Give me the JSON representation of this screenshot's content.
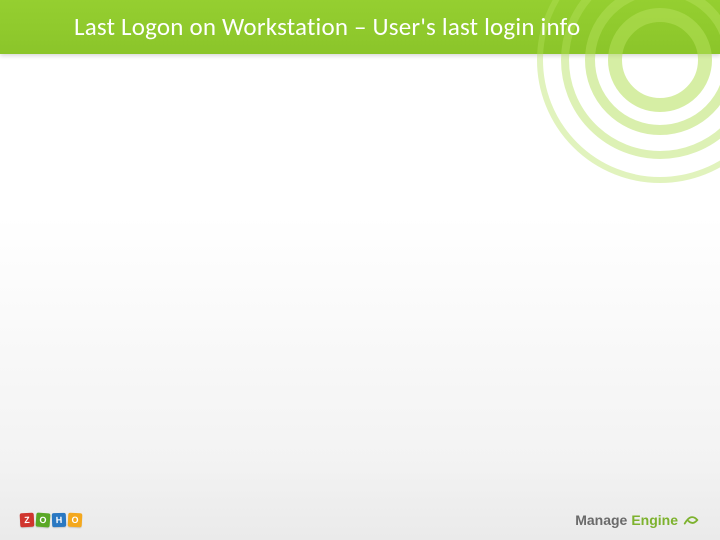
{
  "header": {
    "title": "Last Logon on Workstation – User's last login info"
  },
  "footer": {
    "left_logo": {
      "name": "ZOHO",
      "letters": [
        "Z",
        "O",
        "H",
        "O"
      ]
    },
    "right_logo": {
      "word1": "Manage",
      "word2": "Engine"
    }
  }
}
